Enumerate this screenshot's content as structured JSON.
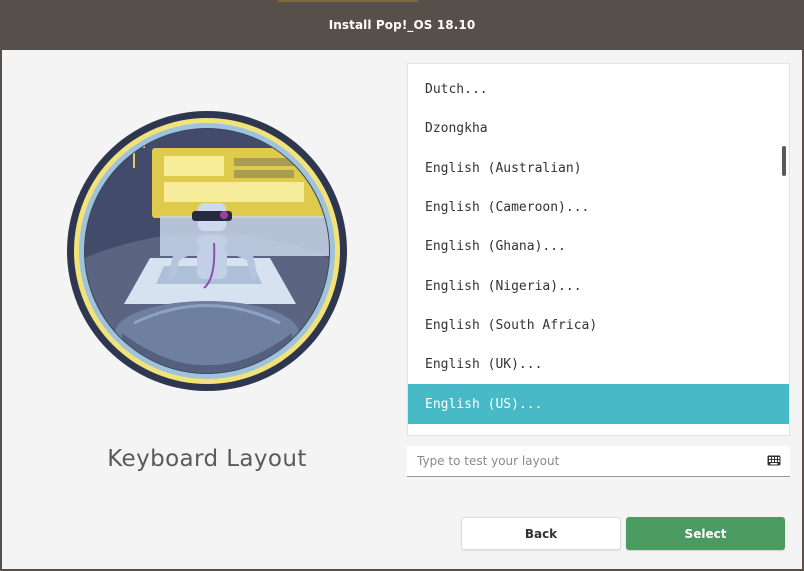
{
  "window": {
    "title": "Install Pop!_OS 18.10"
  },
  "illustration": {
    "icon": "robot-keyboard-illustration"
  },
  "section_title": "Keyboard Layout",
  "layout_list": {
    "items": [
      {
        "label": "Dutch..."
      },
      {
        "label": "Dzongkha"
      },
      {
        "label": "English (Australian)"
      },
      {
        "label": "English (Cameroon)..."
      },
      {
        "label": "English (Ghana)..."
      },
      {
        "label": "English (Nigeria)..."
      },
      {
        "label": "English (South Africa)"
      },
      {
        "label": "English (UK)..."
      },
      {
        "label": "English (US)..."
      }
    ],
    "selected": "English (US)..."
  },
  "test_field": {
    "placeholder": "Type to test your layout",
    "value": "",
    "icon": "keyboard-icon"
  },
  "buttons": {
    "back_label": "Back",
    "select_label": "Select"
  },
  "colors": {
    "titlebar": "#574f4a",
    "selection": "#48b9c7",
    "select_button": "#4b9a62"
  }
}
